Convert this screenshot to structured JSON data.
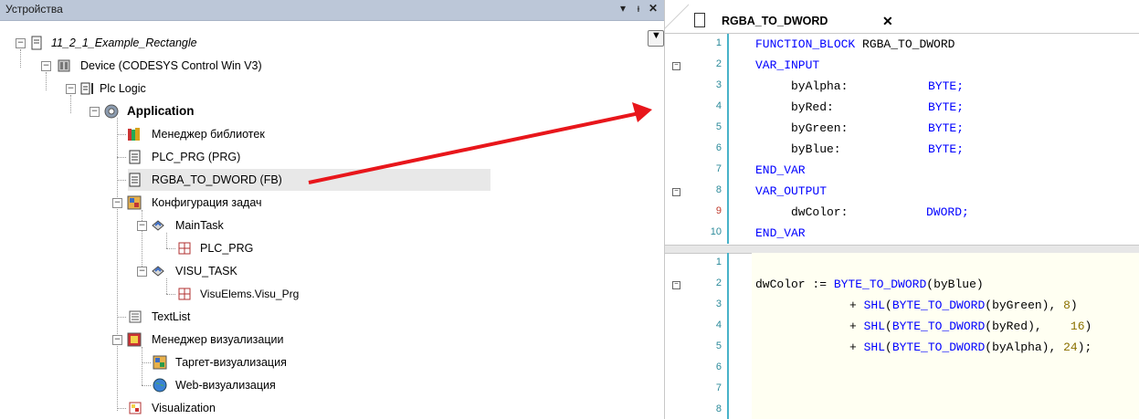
{
  "left_panel": {
    "title": "Устройства",
    "pin_glyph": "▾",
    "pin2_glyph": "ᵻ",
    "close_glyph": "✕"
  },
  "tree": {
    "project": "11_2_1_Example_Rectangle",
    "device": "Device (CODESYS Control Win V3)",
    "plc_logic": "Plc Logic",
    "application": "Application",
    "library_manager": "Менеджер библиотек",
    "plc_prg": "PLC_PRG (PRG)",
    "rgba_fb": "RGBA_TO_DWORD (FB)",
    "task_config": "Конфигурация задач",
    "main_task": "MainTask",
    "main_task_call": "PLC_PRG",
    "visu_task": "VISU_TASK",
    "visu_task_call": "VisuElems.Visu_Prg",
    "text_list": "TextList",
    "visu_manager": "Менеджер визуализации",
    "target_visu": "Таргет-визуализация",
    "web_visu": "Web-визуализация",
    "visualization": "Visualization"
  },
  "editor": {
    "tab_label": "RGBA_TO_DWORD",
    "tab_close": "✕",
    "declaration_lines": [
      {
        "n": "1",
        "text": "FUNCTION_BLOCK RGBA_TO_DWORD"
      },
      {
        "n": "2",
        "text": "VAR_INPUT"
      },
      {
        "n": "3",
        "name": "byAlpha:",
        "type": "BYTE;"
      },
      {
        "n": "4",
        "name": "byRed:",
        "type": "BYTE;"
      },
      {
        "n": "5",
        "name": "byGreen:",
        "type": "BYTE;"
      },
      {
        "n": "6",
        "name": "byBlue:",
        "type": "BYTE;"
      },
      {
        "n": "7",
        "text": "END_VAR"
      },
      {
        "n": "8",
        "text": "VAR_OUTPUT"
      },
      {
        "n": "9",
        "name": "dwColor:",
        "type": "DWORD;"
      },
      {
        "n": "10",
        "text": "END_VAR"
      }
    ],
    "implementation_lines": [
      {
        "n": "1",
        "text": ""
      },
      {
        "n": "2",
        "text": "dwColor := BYTE_TO_DWORD(byBlue)"
      },
      {
        "n": "3",
        "text": "+ SHL(BYTE_TO_DWORD(byGreen), 8)"
      },
      {
        "n": "4",
        "text": "+ SHL(BYTE_TO_DWORD(byRed),    16)"
      },
      {
        "n": "5",
        "text": "+ SHL(BYTE_TO_DWORD(byAlpha), 24);"
      },
      {
        "n": "6",
        "text": ""
      },
      {
        "n": "7",
        "text": ""
      },
      {
        "n": "8",
        "text": ""
      }
    ]
  },
  "colors": {
    "keyword": "#0000ff",
    "line_number": "#2b8a9a",
    "accent_bar": "#48b2c9",
    "arrow": "#e8161b"
  },
  "icons": {
    "fold_minus": "−"
  }
}
